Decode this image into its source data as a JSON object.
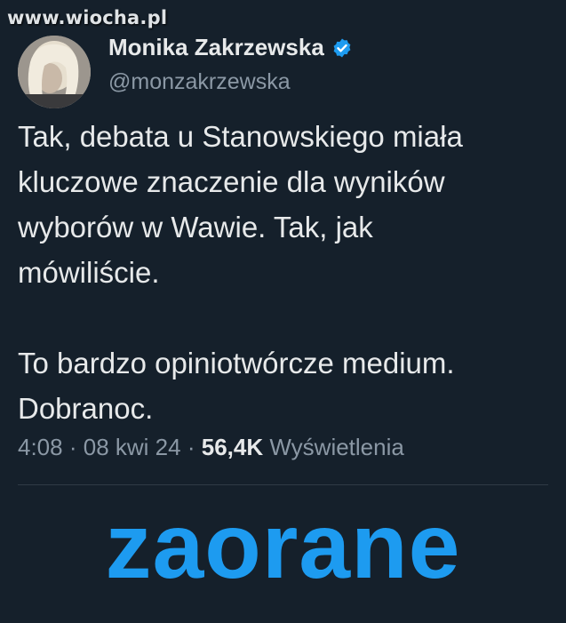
{
  "watermark": {
    "text": "www.wiocha.pl"
  },
  "author": {
    "name": "Monika Zakrzewska",
    "handle": "@monzakrzewska",
    "verified_icon": "verified-badge-icon",
    "verified_color": "#1d9bf0"
  },
  "tweet": {
    "paragraph1_lines": [
      "Tak, debata u Stanowskiego miała",
      "kluczowe znaczenie dla wyników",
      "wyborów w Wawie. Tak, jak",
      "mówiliście."
    ],
    "paragraph2_lines": [
      "To bardzo opiniotwórcze medium.",
      "Dobranoc."
    ]
  },
  "meta": {
    "time": "4:08",
    "date": "08 kwi 24",
    "views_count": "56,4K",
    "views_label": "Wyświetlenia",
    "separator": "·"
  },
  "caption": {
    "text": "zaorane",
    "color": "#1d9bf0"
  },
  "colors": {
    "background": "#15202b",
    "text_primary": "#e7e9ea",
    "text_secondary": "#8b98a5"
  }
}
